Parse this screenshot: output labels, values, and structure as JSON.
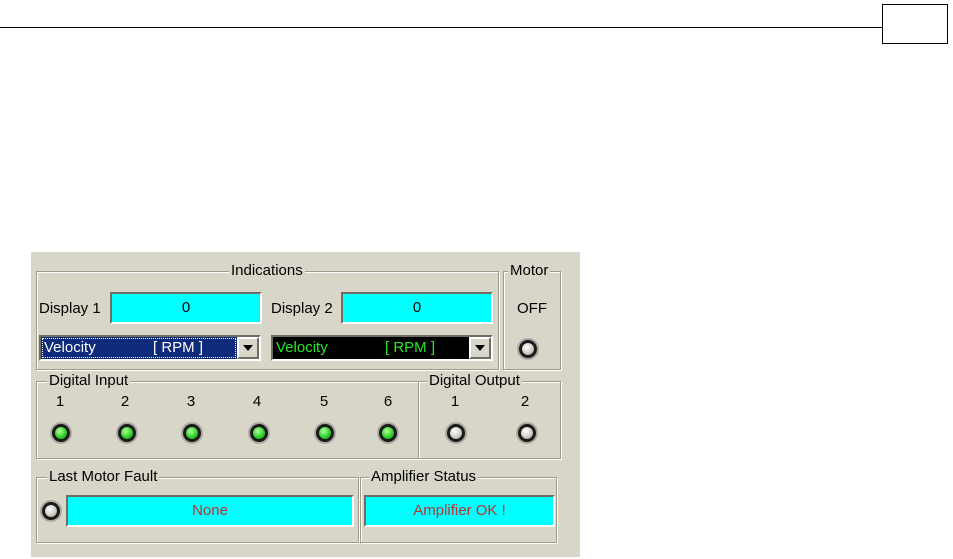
{
  "panel": {
    "indications": {
      "title": "Indications",
      "display1": {
        "label": "Display 1",
        "value": "0",
        "select_text": "Velocity",
        "select_unit": "[ RPM ]"
      },
      "display2": {
        "label": "Display 2",
        "value": "0",
        "select_text": "Velocity",
        "select_unit": "[ RPM ]"
      }
    },
    "motor": {
      "title": "Motor",
      "state": "OFF",
      "led": "off"
    },
    "digital_input": {
      "title": "Digital Input",
      "channels": [
        {
          "label": "1",
          "led": "on"
        },
        {
          "label": "2",
          "led": "on"
        },
        {
          "label": "3",
          "led": "on"
        },
        {
          "label": "4",
          "led": "on"
        },
        {
          "label": "5",
          "led": "on"
        },
        {
          "label": "6",
          "led": "on"
        }
      ]
    },
    "digital_output": {
      "title": "Digital Output",
      "channels": [
        {
          "label": "1",
          "led": "off"
        },
        {
          "label": "2",
          "led": "off"
        }
      ]
    },
    "last_motor_fault": {
      "title": "Last Motor Fault",
      "value": "None",
      "led": "off"
    },
    "amplifier_status": {
      "title": "Amplifier Status",
      "value": "Amplifier OK !"
    }
  },
  "colors": {
    "panel_bg": "#d8d6c8",
    "field_bg": "#00ffff",
    "field_text_red": "#b4332a",
    "combo1_bg": "#0e2a7a",
    "combo2_bg": "#000000",
    "combo2_text": "#22e82a",
    "led_on": "#2fd12a"
  }
}
